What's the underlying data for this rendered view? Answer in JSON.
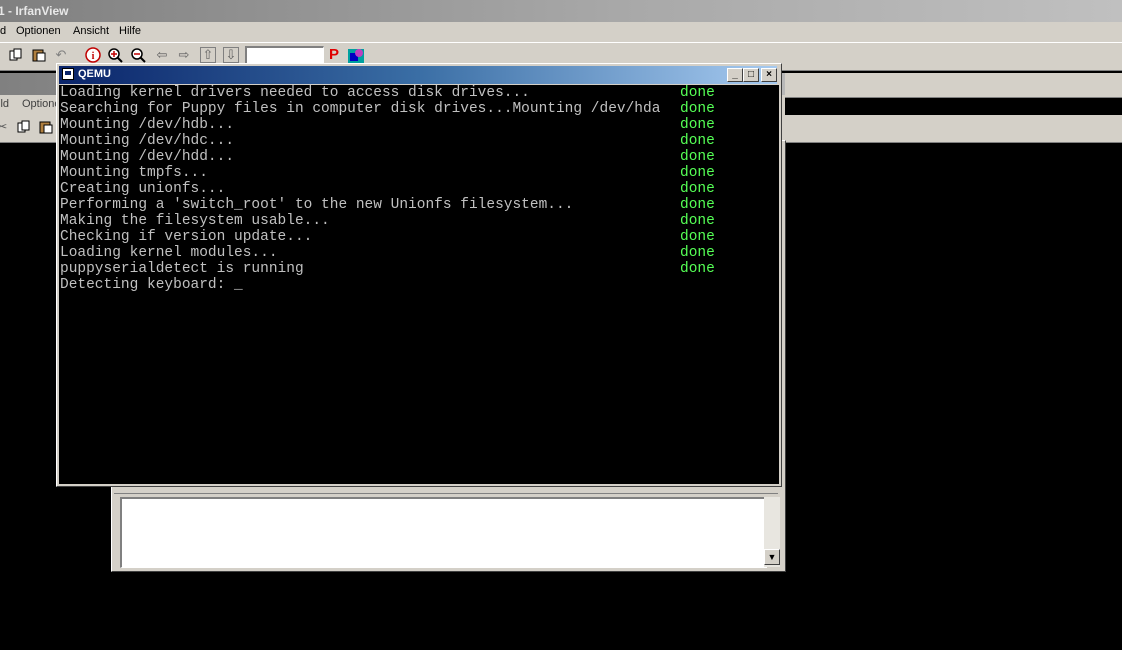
{
  "irfanview": {
    "title": "1 - IrfanView",
    "menu": [
      "d",
      "Optionen",
      "Ansicht",
      "Hilfe"
    ],
    "second_menu": [
      "ild",
      "Optione"
    ],
    "toolbar_icons": [
      "copy-icon",
      "paste-icon",
      "undo-icon",
      "info-icon",
      "zoom-in-icon",
      "zoom-out-icon",
      "arrow-left-icon",
      "arrow-right-icon",
      "arrow-up-icon",
      "arrow-down-icon",
      "paint-icon",
      "color-icon"
    ],
    "page_field_value": ""
  },
  "qemu": {
    "title": "QEMU",
    "lines": [
      {
        "text": "Loading kernel drivers needed to access disk drives...",
        "status": "done"
      },
      {
        "text": "Searching for Puppy files in computer disk drives...Mounting /dev/hda",
        "status": "done"
      },
      {
        "text": "Mounting /dev/hdb...",
        "status": "done"
      },
      {
        "text": "Mounting /dev/hdc...",
        "status": "done"
      },
      {
        "text": "Mounting /dev/hdd...",
        "status": "done"
      },
      {
        "text": "Mounting tmpfs...",
        "status": "done"
      },
      {
        "text": "Creating unionfs...",
        "status": "done"
      },
      {
        "text": "Performing a 'switch_root' to the new Unionfs filesystem...",
        "status": "done"
      },
      {
        "text": "Making the filesystem usable...",
        "status": "done"
      },
      {
        "text": "Checking if version update...",
        "status": "done"
      },
      {
        "text": "Loading kernel modules...",
        "status": "done"
      },
      {
        "text": "puppyserialdetect is running",
        "status": "done"
      }
    ],
    "prompt": "Detecting keyboard: _",
    "colors": {
      "text": "#c0c0c0",
      "done": "#55ff55",
      "titlebar": "#0a246a"
    }
  }
}
